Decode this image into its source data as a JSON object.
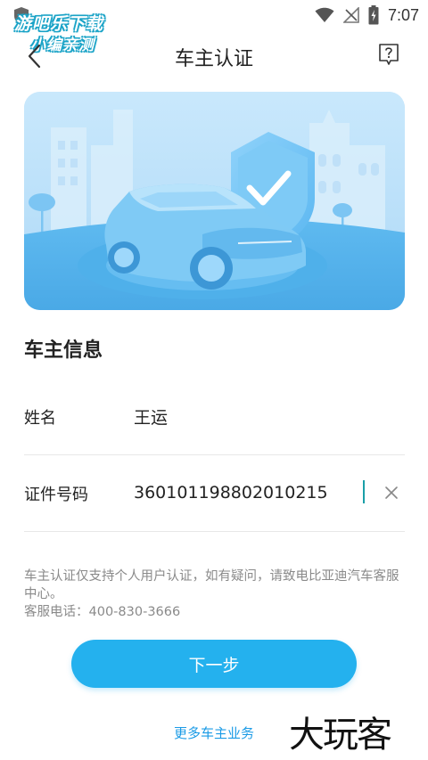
{
  "status_bar": {
    "time": "7:07",
    "icons": [
      "app-shield-icon",
      "wifi-icon",
      "signal-off-icon",
      "battery-icon"
    ]
  },
  "watermark": {
    "line1": "游吧乐下载",
    "line2": "小编亲测"
  },
  "header": {
    "title": "车主认证",
    "back_icon": "chevron-left-icon",
    "help_icon": "question-box-icon"
  },
  "banner": {
    "icons": [
      "car-illustration",
      "shield-check-icon",
      "tree-icon"
    ],
    "colors": {
      "sky": "#bfe2fa",
      "ground": "#55b3ec",
      "car": "#7fcaf5",
      "shield": "#6ec0f4"
    }
  },
  "owner_info": {
    "section_title": "车主信息",
    "name_label": "姓名",
    "name_value": "王运",
    "id_label": "证件号码",
    "id_value": "360101198802010215"
  },
  "notice": {
    "line1": "车主认证仅支持个人用户认证，如有疑问，请致电比亚迪汽车客服中心。",
    "line2": "客服电话：400-830-3666"
  },
  "actions": {
    "next_label": "下一步",
    "more_label": "更多车主业务",
    "accent_color": "#24b1ee"
  },
  "corner_logo": "大玩客"
}
